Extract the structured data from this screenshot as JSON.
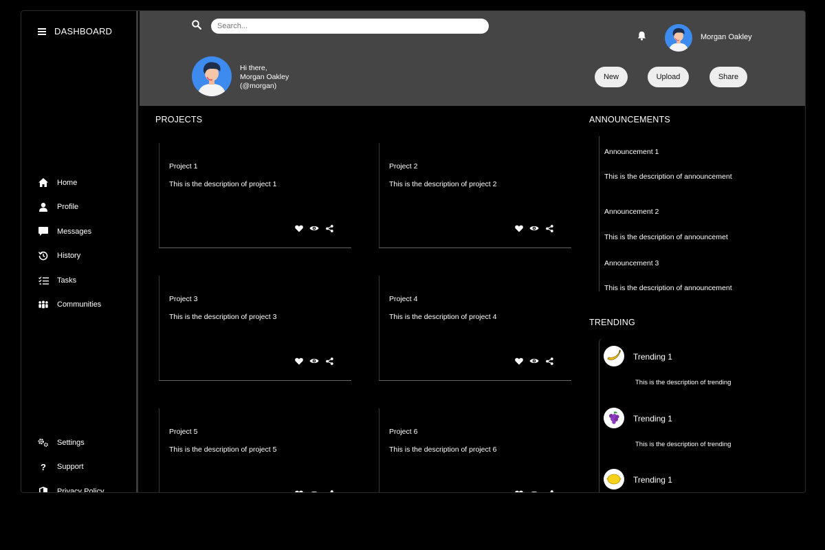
{
  "sidebar": {
    "brand": "DASHBOARD",
    "nav": [
      {
        "label": "Home",
        "icon": "home-icon"
      },
      {
        "label": "Profile",
        "icon": "user-icon"
      },
      {
        "label": "Messages",
        "icon": "message-icon"
      },
      {
        "label": "History",
        "icon": "history-icon"
      },
      {
        "label": "Tasks",
        "icon": "tasks-icon"
      },
      {
        "label": "Communities",
        "icon": "communities-icon"
      }
    ],
    "footer": [
      {
        "label": "Settings",
        "icon": "gear-icon"
      },
      {
        "label": "Support",
        "icon": "question-icon"
      },
      {
        "label": "Privacy Policy",
        "icon": "shield-icon"
      }
    ]
  },
  "header": {
    "search_placeholder": "Search...",
    "user_name": "Morgan Oakley",
    "greeting_line1": "Hi there,",
    "greeting_line2": "Morgan Oakley",
    "greeting_line3": "(@morgan)",
    "buttons": {
      "new": "New",
      "upload": "Upload",
      "share": "Share"
    }
  },
  "projects": {
    "title": "PROJECTS",
    "items": [
      {
        "title": "Project 1",
        "desc": "This is the description of project 1"
      },
      {
        "title": "Project 2",
        "desc": "This is the description of project 2"
      },
      {
        "title": "Project 3",
        "desc": "This is the description of project 3"
      },
      {
        "title": "Project 4",
        "desc": "This is the description of project 4"
      },
      {
        "title": "Project 5",
        "desc": "This is the description of project 5"
      },
      {
        "title": "Project 6",
        "desc": "This is the description of project 6"
      }
    ]
  },
  "announcements": {
    "title": "ANNOUNCEMENTS",
    "items": [
      {
        "title": "Announcement 1",
        "desc": "This is the description of announcement"
      },
      {
        "title": "Announcement 2",
        "desc": "This is the description of announcemet"
      },
      {
        "title": "Announcement 3",
        "desc": "This is the description of announcement"
      }
    ]
  },
  "trending": {
    "title": "TRENDING",
    "items": [
      {
        "title": "Trending 1",
        "desc": "This is the description of trending",
        "icon": "banana-icon"
      },
      {
        "title": "Trending 1",
        "desc": "This is the description of trending",
        "icon": "grapes-icon"
      },
      {
        "title": "Trending 1",
        "desc": "",
        "icon": "lemon-icon"
      }
    ]
  },
  "colors": {
    "header_bg": "#454545",
    "page_bg": "#000000",
    "avatar_blue": "#3d8bef"
  }
}
